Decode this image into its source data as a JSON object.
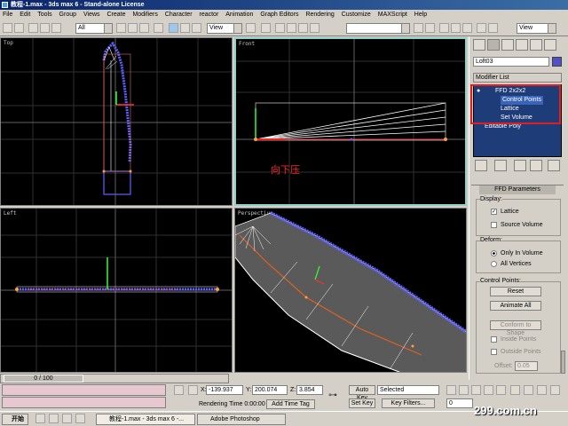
{
  "window": {
    "title": "教程-1.max - 3ds max 6 - Stand-alone License"
  },
  "menu": [
    "File",
    "Edit",
    "Tools",
    "Group",
    "Views",
    "Create",
    "Modifiers",
    "Character",
    "reactor",
    "Animation",
    "Graph Editors",
    "Rendering",
    "Customize",
    "MAXScript",
    "Help"
  ],
  "toolbar": {
    "selection_filter": "All",
    "ref_coord": "View",
    "ref_coord2": "View"
  },
  "viewports": {
    "top": "Top",
    "front": "Front",
    "left": "Left",
    "perspective": "Perspective"
  },
  "annotation": "向下压",
  "command_panel": {
    "object_name": "Loft03",
    "modifier_list": "Modifier List",
    "stack": [
      "FFD 2x2x2",
      "Control Points",
      "Lattice",
      "Set Volume",
      "Editable Poly"
    ]
  },
  "ffd_params": {
    "title": "FFD Parameters",
    "display_label": "Display:",
    "lattice": "Lattice",
    "source_volume": "Source Volume",
    "deform_label": "Deform:",
    "only_in_volume": "Only In Volume",
    "all_vertices": "All Vertices",
    "control_points_label": "Control Points:",
    "reset": "Reset",
    "animate_all": "Animate All",
    "conform": "Conform to Shape",
    "inside_points": "Inside Points",
    "outside_points": "Outside Points",
    "offset_label": "Offset:",
    "offset_value": "0.05"
  },
  "timeline": {
    "frame": "0 / 100"
  },
  "status": {
    "x_label": "X:",
    "x": "-139.937",
    "y_label": "Y:",
    "y": "200.074",
    "z_label": "Z:",
    "z": "3.854",
    "rendering_time": "Rendering Time  0:00:00",
    "add_time_tag": "Add Time Tag",
    "auto_key": "Auto Key",
    "selected": "Selected",
    "set_key": "Set Key",
    "key_filters": "Key Filters...",
    "frame_field": "0"
  },
  "taskbar": {
    "start": "开始",
    "tasks": [
      "教程-1.max - 3ds max 6 -...",
      "Adobe Photoshop"
    ]
  },
  "watermark": "299.com.cn",
  "colors": {
    "stack_bg": "#1e3c78",
    "highlight": "#e02020",
    "viewport_bg": "#000000",
    "active_border": "#8fd0c8"
  }
}
